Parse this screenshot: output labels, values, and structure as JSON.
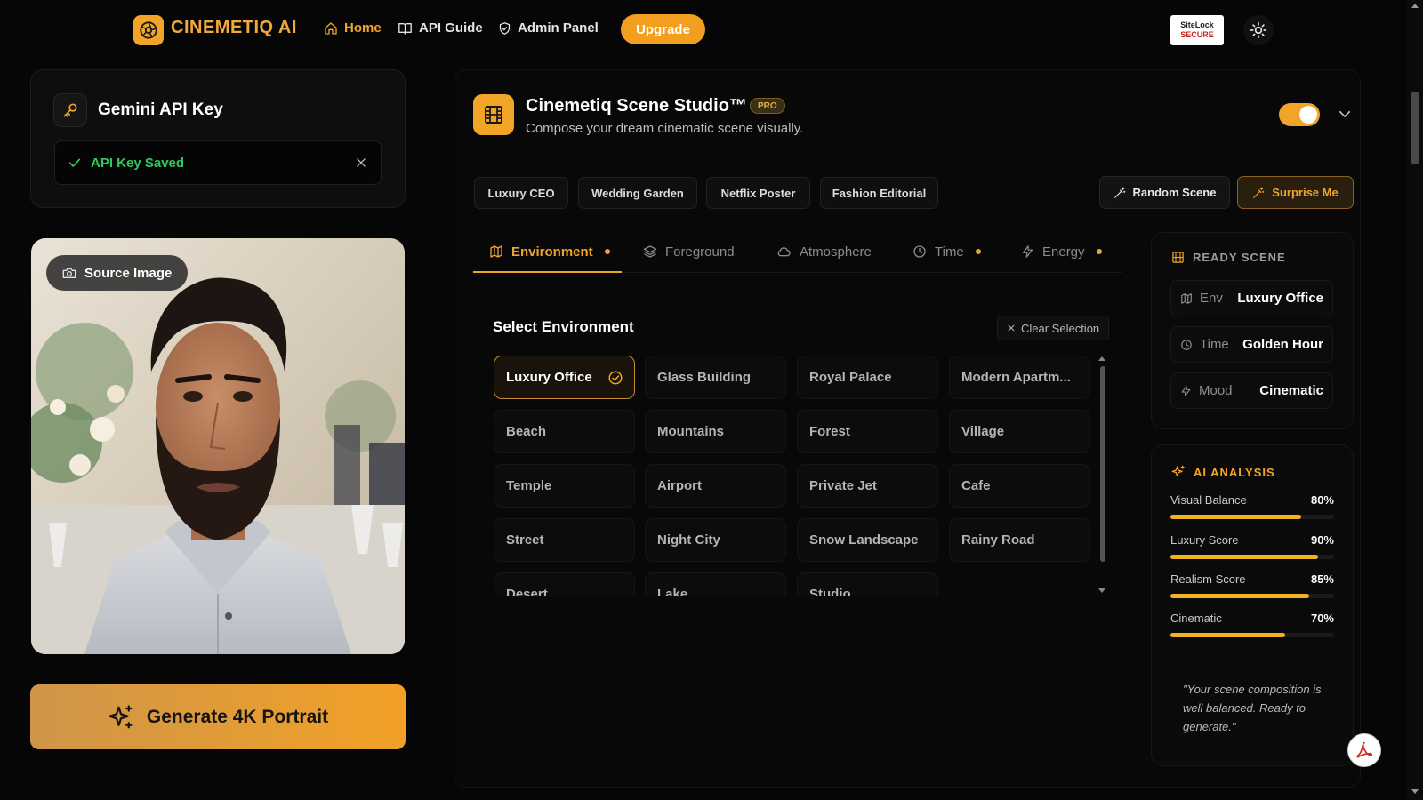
{
  "header": {
    "brand": "CINEMETIQ AI",
    "nav": [
      {
        "label": "Home",
        "icon": "home-icon"
      },
      {
        "label": "API Guide",
        "icon": "book-icon"
      },
      {
        "label": "Admin Panel",
        "icon": "shield-icon"
      }
    ],
    "upgrade": "Upgrade",
    "sitelock": {
      "line1": "SiteLock",
      "line2": "SECURE"
    }
  },
  "api_key": {
    "title": "Gemini API Key",
    "status": "API Key Saved",
    "status_color": "#31c85e"
  },
  "source_image": {
    "label": "Source Image"
  },
  "generate": {
    "label": "Generate 4K Portrait"
  },
  "studio": {
    "title": "Cinemetiq Scene Studio™",
    "badge": "PRO",
    "subtitle": "Compose your dream cinematic scene visually.",
    "presets": [
      "Luxury CEO",
      "Wedding Garden",
      "Netflix Poster",
      "Fashion Editorial"
    ],
    "random_scene": "Random Scene",
    "surprise_me": "Surprise Me",
    "tabs": [
      {
        "label": "Environment",
        "dot": true,
        "active": true
      },
      {
        "label": "Foreground",
        "dot": false
      },
      {
        "label": "Atmosphere",
        "dot": false
      },
      {
        "label": "Time",
        "dot": true
      },
      {
        "label": "Energy",
        "dot": true
      }
    ],
    "select_title": "Select Environment",
    "clear_selection": "Clear Selection",
    "environments": [
      "Luxury Office",
      "Glass Building",
      "Royal Palace",
      "Modern Apartm...",
      "Beach",
      "Mountains",
      "Forest",
      "Village",
      "Temple",
      "Airport",
      "Private Jet",
      "Cafe",
      "Street",
      "Night City",
      "Snow Landscape",
      "Rainy Road",
      "Desert",
      "Lake",
      "Studio"
    ],
    "selected_environment": "Luxury Office"
  },
  "ready_scene": {
    "title": "READY SCENE",
    "rows": [
      {
        "key": "Env",
        "value": "Luxury Office"
      },
      {
        "key": "Time",
        "value": "Golden Hour"
      },
      {
        "key": "Mood",
        "value": "Cinematic"
      }
    ]
  },
  "ai_analysis": {
    "title": "AI ANALYSIS",
    "metrics": [
      {
        "label": "Visual Balance",
        "value": "80%",
        "fraction": 0.8
      },
      {
        "label": "Luxury Score",
        "value": "90%",
        "fraction": 0.9
      },
      {
        "label": "Realism Score",
        "value": "85%",
        "fraction": 0.85
      },
      {
        "label": "Cinematic",
        "value": "70%",
        "fraction": 0.7
      }
    ],
    "quote": "\"Your scene composition is well balanced. Ready to generate.\""
  },
  "colors": {
    "accent": "#f0a528",
    "bg": "#060606"
  }
}
